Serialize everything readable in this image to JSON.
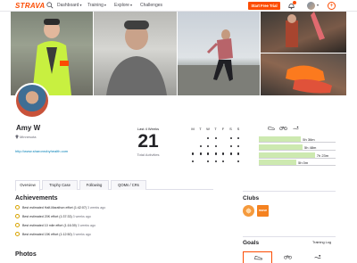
{
  "nav": {
    "logo": "STRAVA",
    "items": [
      {
        "label": "Dashboard",
        "has_caret": true
      },
      {
        "label": "Training",
        "has_caret": true
      },
      {
        "label": "Explore",
        "has_caret": true
      },
      {
        "label": "Challenges",
        "has_caret": false
      }
    ],
    "trial_button": "Start Free Trial",
    "caret": "▾",
    "plus": "+",
    "icons": [
      "search-icon",
      "notification-bell-icon",
      "user-avatar",
      "add-icon"
    ],
    "accent_color": "#fc4c02"
  },
  "profile": {
    "name": "Amy W",
    "location": "Minnesota",
    "link": "http://www.sharonrobyhealth.com"
  },
  "stats": {
    "label": "Last 4 Weeks",
    "activities": "21",
    "activities_label": "Total Activities",
    "days": [
      "M",
      "T",
      "W",
      "T",
      "F",
      "S",
      "S"
    ],
    "weeks": [
      [
        0,
        0,
        1,
        1,
        0,
        1,
        1
      ],
      [
        0,
        1,
        1,
        1,
        0,
        1,
        1
      ],
      [
        1,
        1,
        1,
        1,
        1,
        1,
        1
      ],
      [
        1,
        0,
        1,
        1,
        1,
        0,
        1
      ]
    ],
    "sport_icons": [
      "running-shoe-icon",
      "bike-icon",
      "swim-icon"
    ],
    "weekly_hours": [
      {
        "label": "5h 36m",
        "fraction": 0.55
      },
      {
        "label": "5h 48m",
        "fraction": 0.57
      },
      {
        "label": "7h 23m",
        "fraction": 0.73
      },
      {
        "label": "5h 0m",
        "fraction": 0.49
      }
    ],
    "bar_color": "#cde9b0"
  },
  "tabs": [
    "Overview",
    "Trophy Case",
    "Following",
    "QOMs / CRs"
  ],
  "achievements": {
    "title": "Achievements",
    "items": [
      {
        "text": "Best estimated Half-Marathon effort (1:42:07)",
        "time": "3 weeks ago"
      },
      {
        "text": "Best estimated 20K effort (1:37:33)",
        "time": "3 weeks ago"
      },
      {
        "text": "Best estimated 10 mile effort (1:16:39)",
        "time": "3 weeks ago"
      },
      {
        "text": "Best estimated 15K effort (1:12:50)",
        "time": "3 weeks ago"
      }
    ],
    "icon_color": "#d8a300"
  },
  "photos_title": "Photos",
  "clubs": {
    "title": "Clubs",
    "second_club_label": "move"
  },
  "goals": {
    "title": "Goals",
    "training_log": "Training Log",
    "icons": [
      "running-shoe-icon",
      "bike-icon",
      "swim-icon"
    ]
  }
}
